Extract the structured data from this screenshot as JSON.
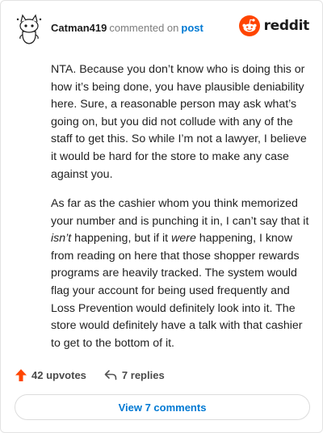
{
  "comment": {
    "username": "Catman419",
    "action_text": "commented on",
    "target_link": "post",
    "paragraphs": [
      [
        {
          "text": "NTA. Because you don’t know who is doing this or how it’s being done, you have plausible deniability here. Sure, a reasonable person may ask what’s going on, but you did not collude with any of the staff to get this. So while I’m not a lawyer, I believe it would be hard for the store to make any case against you.",
          "italic": false
        }
      ],
      [
        {
          "text": "As far as the cashier whom you think memorized your number and is punching it in, I can’t say that it ",
          "italic": false
        },
        {
          "text": "isn’t",
          "italic": true
        },
        {
          "text": " happening, but if it ",
          "italic": false
        },
        {
          "text": "were",
          "italic": true
        },
        {
          "text": " happening, I know from reading on here that those shopper rewards programs are heavily tracked. The system would flag your account for being used frequently and Loss Prevention would definitely look into it. The store would definitely have a talk with that cashier to get to the bottom of it.",
          "italic": false
        }
      ]
    ]
  },
  "logo": {
    "text": "reddit",
    "icon": "reddit-alien-icon",
    "color": "#ff4500"
  },
  "footer": {
    "upvotes_label": "42 upvotes",
    "replies_label": "7 replies",
    "upvote_icon": "arrow-up-icon",
    "reply_icon": "reply-arrow-icon"
  },
  "view_button_label": "View 7 comments",
  "colors": {
    "accent": "#0079d3",
    "upvote": "#ff4500",
    "text": "#222222",
    "muted": "#7c7c7c"
  }
}
